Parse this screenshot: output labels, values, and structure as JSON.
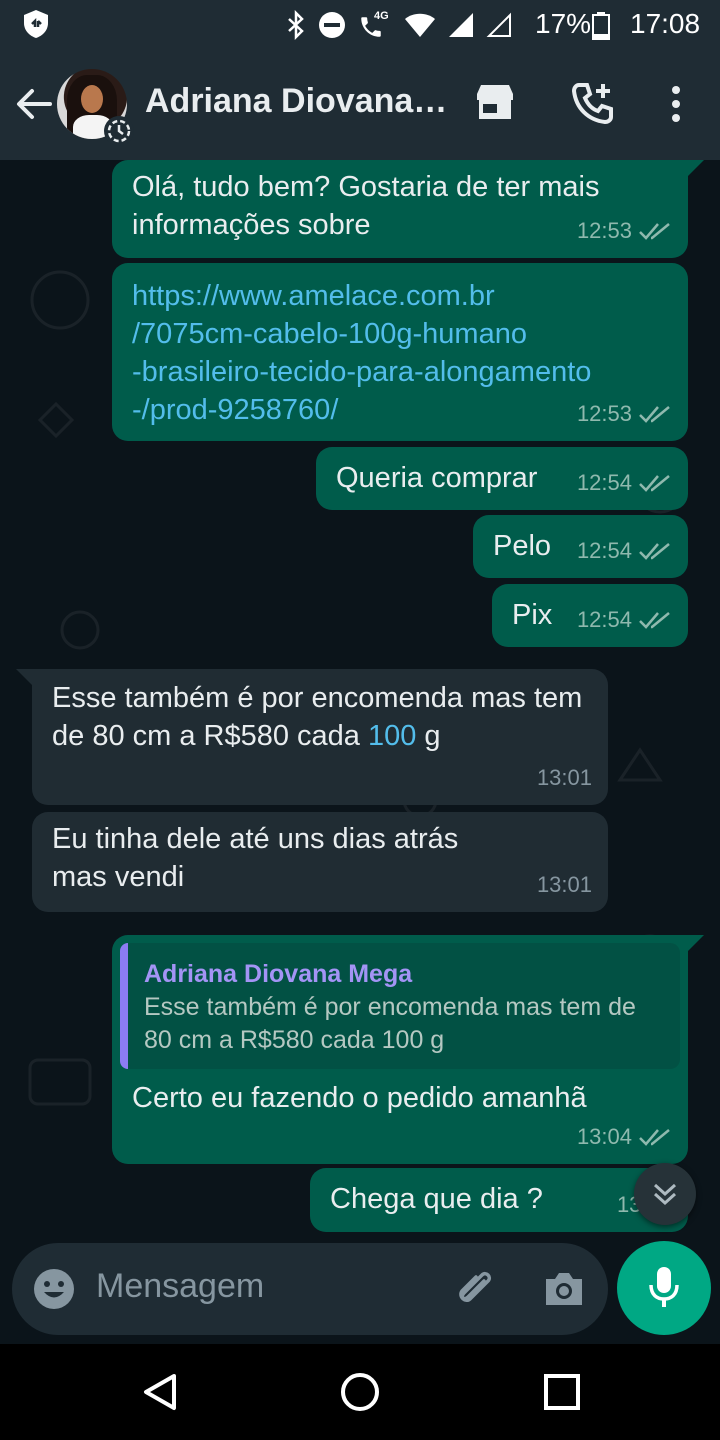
{
  "status_bar": {
    "network_badge": "4G",
    "battery_percent": "17%",
    "time": "17:08"
  },
  "header": {
    "contact_name": "Adriana Diovana…"
  },
  "messages": [
    {
      "direction": "out",
      "text": "Olá, tudo bem? Gostaria de ter mais informações sobre",
      "time": "12:53",
      "status": "double-check-read"
    },
    {
      "direction": "out",
      "text": "https://www.amelace.com.br/7075cm-cabelo-100g-humano-brasileiro-tecido-para-alongamento-/prod-9258760/",
      "time": "12:53",
      "status": "double-check-read"
    },
    {
      "direction": "out",
      "text": "Queria comprar",
      "time": "12:54",
      "status": "double-check-read"
    },
    {
      "direction": "out",
      "text": "Pelo",
      "time": "12:54",
      "status": "double-check-read"
    },
    {
      "direction": "out",
      "text": "Pix",
      "time": "12:54",
      "status": "double-check-read"
    },
    {
      "direction": "in",
      "text_before": "Esse também é por encomenda mas tem de 80 cm a R$580 cada ",
      "text_link": "100",
      "text_after": " g",
      "time": "13:01"
    },
    {
      "direction": "in",
      "text": "Eu tinha dele até uns dias atrás mas vendi",
      "time": "13:01"
    },
    {
      "direction": "out",
      "quote_author": "Adriana Diovana Mega",
      "quote_text": "Esse também é por encomenda mas tem de 80 cm a R$580 cada 100 g",
      "text": "Certo eu fazendo o pedido amanhã",
      "time": "13:04",
      "status": "double-check-read"
    },
    {
      "direction": "out",
      "text": "Chega que dia ?",
      "time": "13:04"
    }
  ],
  "link_lines": [
    "https://www.amelace.com.br",
    "/7075cm-cabelo-100g-humano",
    "-brasileiro-tecido-para-alongamento",
    "-/prod-9258760/"
  ],
  "composer": {
    "placeholder": "Mensagem"
  },
  "colors": {
    "background": "#0b141a",
    "header": "#1f2c34",
    "outgoing_bubble": "#005c4b",
    "incoming_bubble": "#202c33",
    "link": "#53bdeb",
    "quote_author": "#a394f5",
    "accent_green": "#00a884"
  },
  "icons": {
    "status_bar": [
      "shield-icon",
      "bluetooth-icon",
      "do-not-disturb-icon",
      "call-4g-icon",
      "wifi-icon",
      "signal-icon",
      "signal-empty-icon",
      "battery-icon"
    ],
    "header": [
      "back-arrow-icon",
      "store-icon",
      "add-call-icon",
      "more-vert-icon"
    ],
    "composer": [
      "emoji-icon",
      "paperclip-icon",
      "camera-icon",
      "mic-icon"
    ],
    "nav": [
      "nav-back-icon",
      "nav-home-icon",
      "nav-recents-icon"
    ]
  }
}
